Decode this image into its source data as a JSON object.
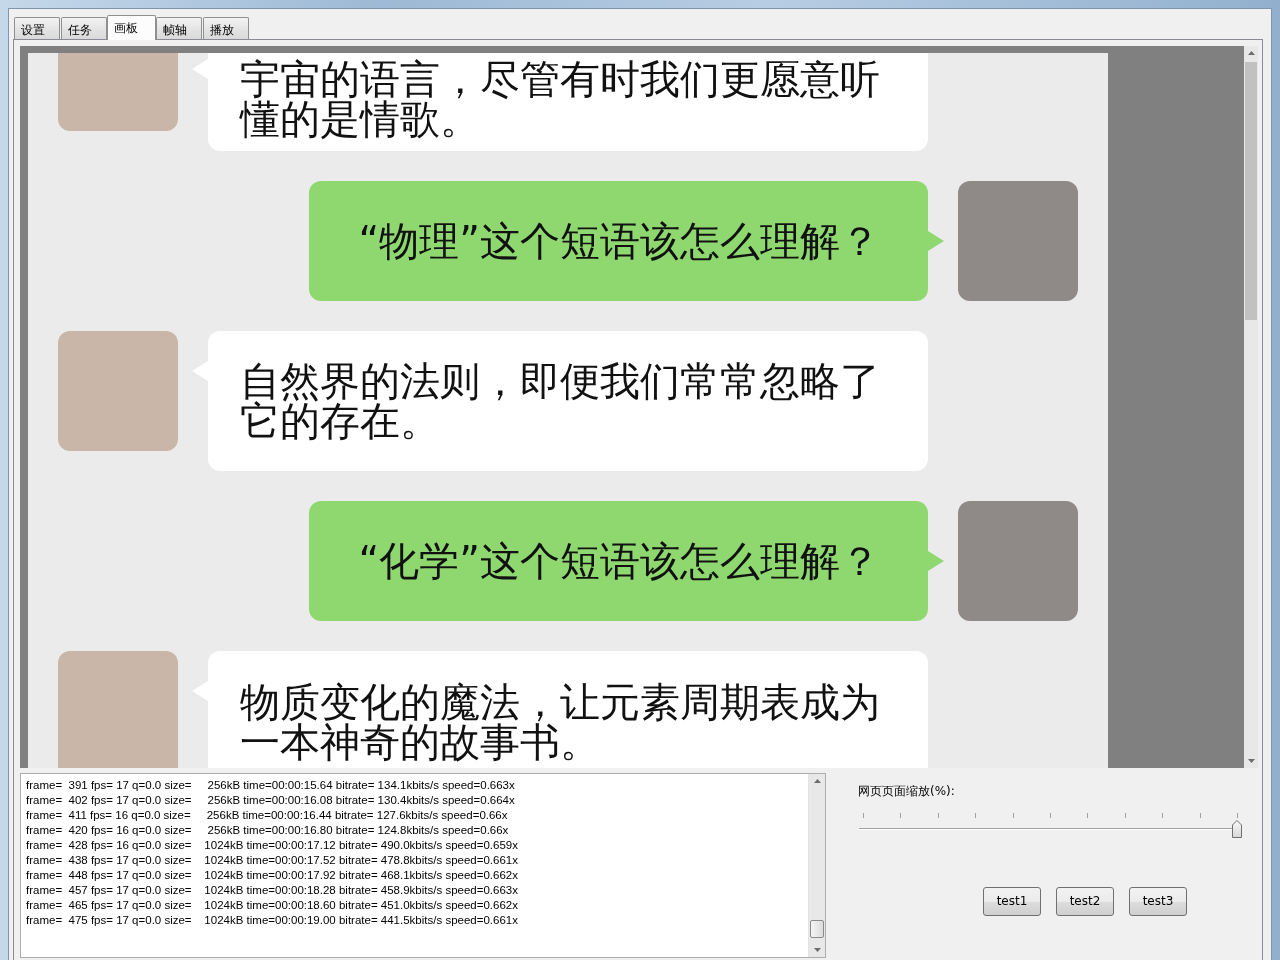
{
  "window": {
    "tabs": [
      {
        "label": "设置",
        "selected": false
      },
      {
        "label": "任务",
        "selected": false
      },
      {
        "label": "画板",
        "selected": true
      },
      {
        "label": "帧轴",
        "selected": false
      },
      {
        "label": "播放",
        "selected": false
      }
    ]
  },
  "chat": {
    "messages": [
      {
        "kind": "received",
        "text": "宇宙的语言，尽管有时我们更愿意听懂的是情歌。"
      },
      {
        "kind": "sent",
        "text": "“物理”这个短语该怎么理解？"
      },
      {
        "kind": "received",
        "text": "自然界的法则，即便我们常常忽略了它的存在。"
      },
      {
        "kind": "sent",
        "text": "“化学”这个短语该怎么理解？"
      },
      {
        "kind": "received",
        "text": "物质变化的魔法，让元素周期表成为一本神奇的故事书。"
      }
    ]
  },
  "log": {
    "lines": [
      "frame=  391 fps= 17 q=0.0 size=     256kB time=00:00:15.64 bitrate= 134.1kbits/s speed=0.663x",
      "frame=  402 fps= 17 q=0.0 size=     256kB time=00:00:16.08 bitrate= 130.4kbits/s speed=0.664x",
      "frame=  411 fps= 16 q=0.0 size=     256kB time=00:00:16.44 bitrate= 127.6kbits/s speed=0.66x",
      "frame=  420 fps= 16 q=0.0 size=     256kB time=00:00:16.80 bitrate= 124.8kbits/s speed=0.66x",
      "frame=  428 fps= 16 q=0.0 size=    1024kB time=00:00:17.12 bitrate= 490.0kbits/s speed=0.659x",
      "frame=  438 fps= 17 q=0.0 size=    1024kB time=00:00:17.52 bitrate= 478.8kbits/s speed=0.661x",
      "frame=  448 fps= 17 q=0.0 size=    1024kB time=00:00:17.92 bitrate= 468.1kbits/s speed=0.662x",
      "frame=  457 fps= 17 q=0.0 size=    1024kB time=00:00:18.28 bitrate= 458.9kbits/s speed=0.663x",
      "frame=  465 fps= 17 q=0.0 size=    1024kB time=00:00:18.60 bitrate= 451.0kbits/s speed=0.662x",
      "frame=  475 fps= 17 q=0.0 size=    1024kB time=00:00:19.00 bitrate= 441.5kbits/s speed=0.661x"
    ]
  },
  "zoom": {
    "label": "网页页面缩放(%):",
    "level": 1
  },
  "buttons": [
    "test1",
    "test2",
    "test3"
  ]
}
